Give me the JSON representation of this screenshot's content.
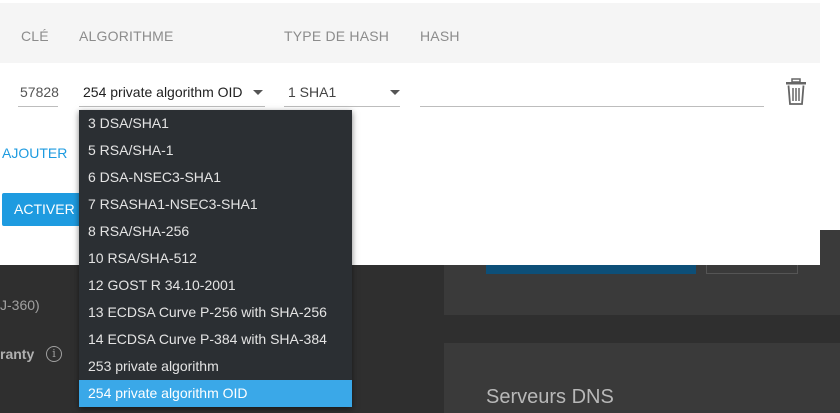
{
  "background": {
    "model_text": "J-360)",
    "warranty_text": "ranty",
    "dns_title": "Serveurs DNS"
  },
  "table": {
    "headers": {
      "key": "CLÉ",
      "algorithm": "ALGORITHME",
      "hash_type": "TYPE DE HASH",
      "hash": "HASH"
    },
    "row": {
      "key": "57828",
      "algorithm": "254 private algorithm OID",
      "hash_type": "1 SHA1",
      "hash": ""
    }
  },
  "actions": {
    "add_label": "AJOUTER",
    "activate_label": "ACTIVER"
  },
  "algorithm_options": [
    "3 DSA/SHA1",
    "5 RSA/SHA-1",
    "6 DSA-NSEC3-SHA1",
    "7 RSASHA1-NSEC3-SHA1",
    "8 RSA/SHA-256",
    "10 RSA/SHA-512",
    "12 GOST R 34.10-2001",
    "13 ECDSA Curve P-256 with SHA-256",
    "14 ECDSA Curve P-384 with SHA-384",
    "253 private algorithm",
    "254 private algorithm OID"
  ],
  "selected_option_index": 10,
  "colors": {
    "accent": "#1e9be0",
    "dropdown_bg": "#2b2f33",
    "selected_bg": "#3aa8e8"
  }
}
